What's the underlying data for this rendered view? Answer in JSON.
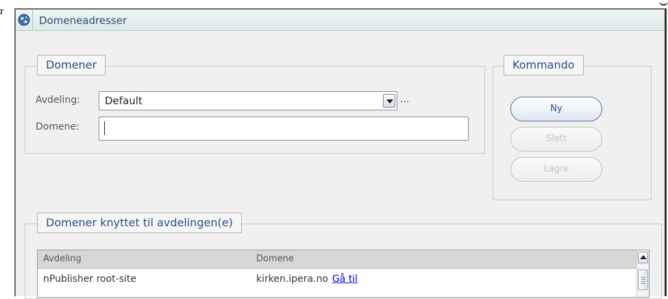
{
  "window": {
    "title": "Domeneadresser",
    "corner_glyph": "r"
  },
  "domener_group": {
    "legend": "Domener",
    "avdeling_label": "Avdeling:",
    "avdeling_value": "Default",
    "more_label": "...",
    "domene_label": "Domene:",
    "domene_value": ""
  },
  "kommando_group": {
    "legend": "Kommando",
    "buttons": [
      {
        "label": "Ny",
        "enabled": true
      },
      {
        "label": "Slett",
        "enabled": false
      },
      {
        "label": "Lagre",
        "enabled": false
      }
    ]
  },
  "linked_group": {
    "legend": "Domener knyttet til avdelingen(e)",
    "columns": [
      "Avdeling",
      "Domene"
    ],
    "rows": [
      {
        "avdeling": "nPublisher root-site",
        "domene": "kirken.ipera.no",
        "link": "Gå til"
      }
    ]
  },
  "icons": {
    "title_icon": "globe-icon",
    "dropdown_icon": "chevron-down-icon",
    "scroll_up_icon": "arrow-up-icon"
  },
  "colors": {
    "legend_text": "#2a4f8a",
    "link": "#0000ee",
    "table_header_bg": "#d7d7d7",
    "window_bg": "#f0f0f0",
    "titlebar_bg": "#dceaea"
  }
}
